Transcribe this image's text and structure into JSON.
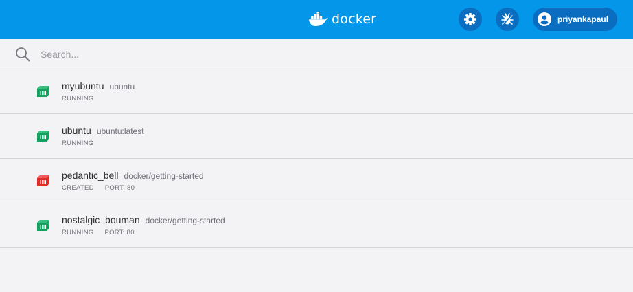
{
  "header": {
    "brand": "docker",
    "username": "priyankapaul",
    "settings_icon": "gear-icon",
    "troubleshoot_icon": "bug-icon",
    "user_icon": "user-avatar-icon"
  },
  "search": {
    "placeholder": "Search...",
    "value": ""
  },
  "containers": [
    {
      "name": "myubuntu",
      "image": "ubuntu",
      "status": "RUNNING",
      "port": "",
      "color": "#16a05f"
    },
    {
      "name": "ubuntu",
      "image": "ubuntu:latest",
      "status": "RUNNING",
      "port": "",
      "color": "#16a05f"
    },
    {
      "name": "pedantic_bell",
      "image": "docker/getting-started",
      "status": "CREATED",
      "port": "PORT: 80",
      "color": "#e02b2b"
    },
    {
      "name": "nostalgic_bouman",
      "image": "docker/getting-started",
      "status": "RUNNING",
      "port": "PORT: 80",
      "color": "#16a05f"
    }
  ],
  "colors": {
    "topbar": "#0396e9",
    "button": "#0a6dbf",
    "running": "#16a05f",
    "created": "#e02b2b"
  }
}
